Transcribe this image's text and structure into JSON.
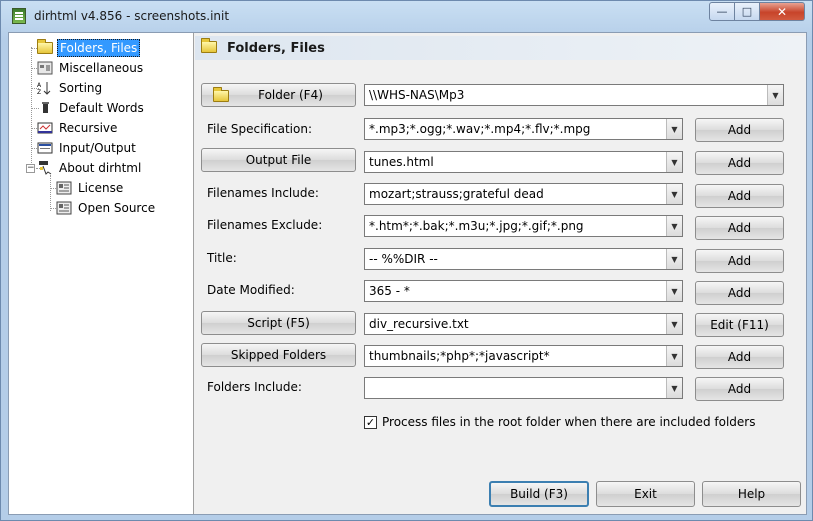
{
  "window": {
    "title": "dirhtml v4.856 - screenshots.init",
    "min_glyph": "—",
    "max_glyph": "□",
    "close_glyph": "✕"
  },
  "tree": {
    "items": [
      {
        "label": "Folders, Files",
        "icon": "folder-icon"
      },
      {
        "label": "Miscellaneous",
        "icon": "misc-icon"
      },
      {
        "label": "Sorting",
        "icon": "sort-icon"
      },
      {
        "label": "Default Words",
        "icon": "words-icon"
      },
      {
        "label": "Recursive",
        "icon": "recursive-icon"
      },
      {
        "label": "Input/Output",
        "icon": "io-icon"
      },
      {
        "label": "About dirhtml",
        "icon": "about-icon"
      },
      {
        "label": "License",
        "icon": "license-icon"
      },
      {
        "label": "Open Source",
        "icon": "open-source-icon"
      }
    ],
    "expander_glyph": "−"
  },
  "panel": {
    "title": "Folders, Files"
  },
  "rows": {
    "folder": {
      "button": "Folder (F4)",
      "value": "\\\\WHS-NAS\\Mp3"
    },
    "file_spec": {
      "label": "File Specification:",
      "value": "*.mp3;*.ogg;*.wav;*.mp4;*.flv;*.mpg",
      "action": "Add"
    },
    "output_file": {
      "button": "Output File",
      "value": "tunes.html",
      "action": "Add"
    },
    "filenames_include": {
      "label": "Filenames Include:",
      "value": "mozart;strauss;grateful dead",
      "action": "Add"
    },
    "filenames_exclude": {
      "label": "Filenames Exclude:",
      "value": "*.htm*;*.bak;*.m3u;*.jpg;*.gif;*.png",
      "action": "Add"
    },
    "title": {
      "label": "Title:",
      "value": "-- %%DIR --",
      "action": "Add"
    },
    "date_modified": {
      "label": "Date Modified:",
      "value": "365 - *",
      "action": "Add"
    },
    "script": {
      "button": "Script (F5)",
      "value": "div_recursive.txt",
      "action": "Edit (F11)"
    },
    "skipped_folders": {
      "button": "Skipped Folders",
      "value": "thumbnails;*php*;*javascript*",
      "action": "Add"
    },
    "folders_include": {
      "label": "Folders Include:",
      "value": "",
      "action": "Add"
    }
  },
  "checkbox": {
    "label": "Process files in the root folder when there are included folders",
    "checked": true,
    "glyph": "✓"
  },
  "footer": {
    "build": "Build (F3)",
    "exit": "Exit",
    "help": "Help"
  },
  "dropdown_glyph": "▼"
}
